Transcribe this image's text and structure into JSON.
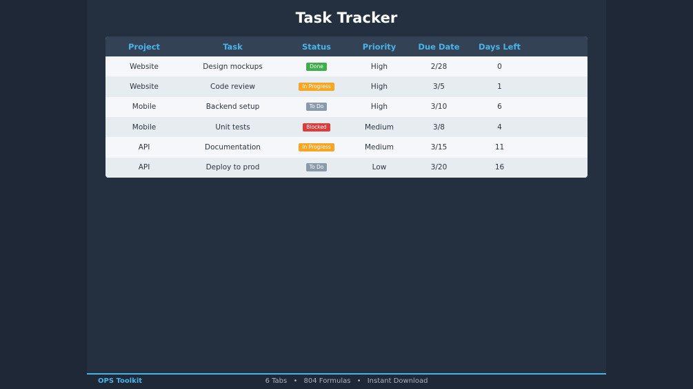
{
  "title": "Task Tracker",
  "table": {
    "columns": [
      "Project",
      "Task",
      "Status",
      "Priority",
      "Due Date",
      "Days Left"
    ],
    "rows": [
      {
        "project": "Website",
        "task": "Design mockups",
        "status": "Done",
        "priority": "High",
        "due": "2/28",
        "days": "0"
      },
      {
        "project": "Website",
        "task": "Code review",
        "status": "In Progress",
        "priority": "High",
        "due": "3/5",
        "days": "1"
      },
      {
        "project": "Mobile",
        "task": "Backend setup",
        "status": "To Do",
        "priority": "High",
        "due": "3/10",
        "days": "6"
      },
      {
        "project": "Mobile",
        "task": "Unit tests",
        "status": "Blocked",
        "priority": "Medium",
        "due": "3/8",
        "days": "4"
      },
      {
        "project": "API",
        "task": "Documentation",
        "status": "In Progress",
        "priority": "Medium",
        "due": "3/15",
        "days": "11"
      },
      {
        "project": "API",
        "task": "Deploy to prod",
        "status": "To Do",
        "priority": "Low",
        "due": "3/20",
        "days": "16"
      }
    ]
  },
  "status_colors": {
    "Done": "#3fae4b",
    "In Progress": "#f5a623",
    "To Do": "#8a9aab",
    "Blocked": "#e03b3b"
  },
  "footer": {
    "brand": "OPS Toolkit",
    "items": [
      "6 Tabs",
      "804 Formulas",
      "Instant Download"
    ],
    "separator": "•"
  },
  "colors": {
    "accent": "#4ab3e8",
    "background": "#243040",
    "header_bg": "#344256"
  }
}
